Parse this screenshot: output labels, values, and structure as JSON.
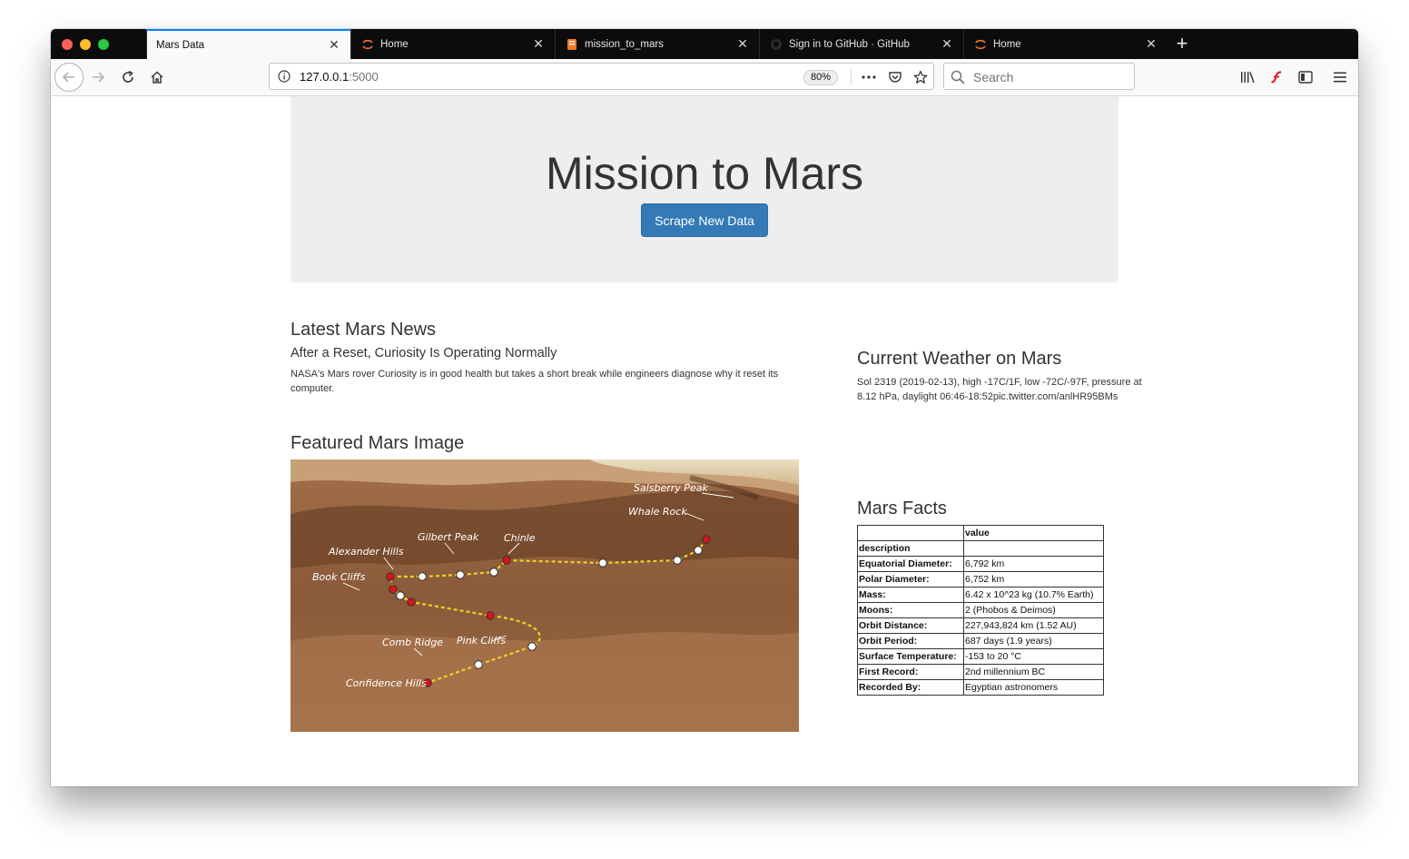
{
  "browser": {
    "tabs": [
      {
        "label": "Mars Data",
        "icon": "none",
        "active": true
      },
      {
        "label": "Home",
        "icon": "jupyter-icon",
        "active": false
      },
      {
        "label": "mission_to_mars",
        "icon": "notebook-icon",
        "active": false
      },
      {
        "label": "Sign in to GitHub · GitHub",
        "icon": "github-icon",
        "active": false
      },
      {
        "label": "Home",
        "icon": "jupyter-icon",
        "active": false
      }
    ],
    "url": {
      "host": "127.0.0.1",
      "port": ":5000"
    },
    "zoom": "80%",
    "search_placeholder": "Search"
  },
  "page": {
    "title": "Mission to Mars",
    "scrape_button": "Scrape New Data",
    "news": {
      "heading": "Latest Mars News",
      "title": "After a Reset, Curiosity Is Operating Normally",
      "paragraph": "NASA's Mars rover Curiosity is in good health but takes a short break while engineers diagnose why it reset its computer."
    },
    "weather": {
      "heading": "Current Weather on Mars",
      "text": "Sol 2319 (2019-02-13), high -17C/1F, low -72C/-97F, pressure at 8.12 hPa, daylight 06:46-18:52pic.twitter.com/anlHR95BMs"
    },
    "featured_image": {
      "heading": "Featured Mars Image",
      "labels": [
        "Salsberry Peak",
        "Whale Rock",
        "Gilbert Peak",
        "Chinle",
        "Alexander Hills",
        "Book Cliffs",
        "Comb Ridge",
        "Pink Cliffs",
        "Confidence Hills"
      ]
    },
    "facts": {
      "heading": "Mars Facts",
      "header": [
        "",
        "value"
      ],
      "index_label": "description",
      "rows": [
        [
          "Equatorial Diameter:",
          "6,792 km"
        ],
        [
          "Polar Diameter:",
          "6,752 km"
        ],
        [
          "Mass:",
          "6.42 x 10^23 kg (10.7% Earth)"
        ],
        [
          "Moons:",
          "2 (Phobos & Deimos)"
        ],
        [
          "Orbit Distance:",
          "227,943,824 km (1.52 AU)"
        ],
        [
          "Orbit Period:",
          "687 days (1.9 years)"
        ],
        [
          "Surface Temperature:",
          "-153 to 20 °C"
        ],
        [
          "First Record:",
          "2nd millennium BC"
        ],
        [
          "Recorded By:",
          "Egyptian astronomers"
        ]
      ]
    }
  }
}
